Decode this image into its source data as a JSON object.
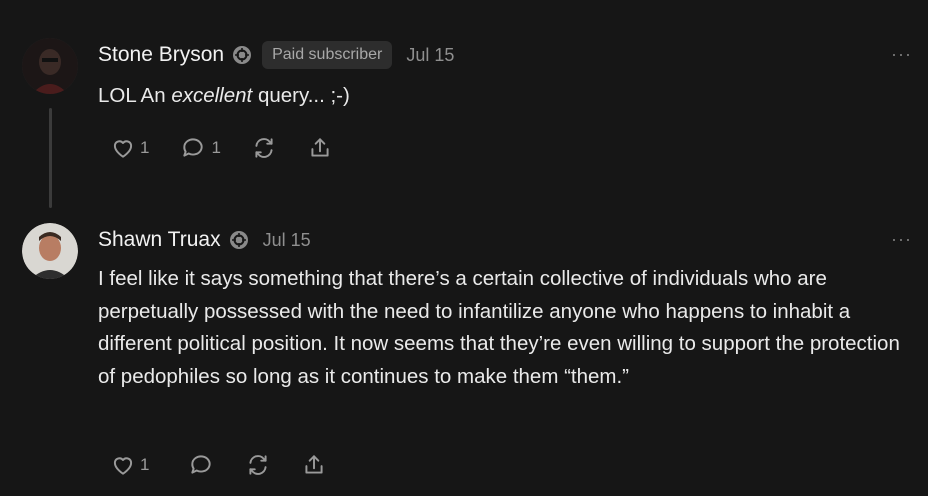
{
  "comments": [
    {
      "author": "Stone Bryson",
      "badge": "Paid subscriber",
      "date": "Jul 15",
      "more": "···",
      "text_pre": "LOL An ",
      "text_em": "excellent",
      "text_post": " query... ;-)",
      "likes": "1",
      "replies": "1"
    },
    {
      "author": "Shawn Truax",
      "date": "Jul 15",
      "more": "···",
      "text": "I feel like it says something that there’s a certain collective of individuals who are perpetually possessed with the need to infantilize anyone who happens to inhabit a different political position. It now seems that they’re even willing to support the protection of pedophiles so long as it continues to make them “them.”",
      "likes": "1"
    }
  ],
  "icons": {
    "like": "heart-icon",
    "reply": "speech-bubble-icon",
    "restack": "restack-icon",
    "share": "share-icon",
    "badge": "subscriber-badge-icon"
  },
  "colors": {
    "background": "#161616",
    "text": "#e8e8e8",
    "muted": "#8f8f8f"
  }
}
